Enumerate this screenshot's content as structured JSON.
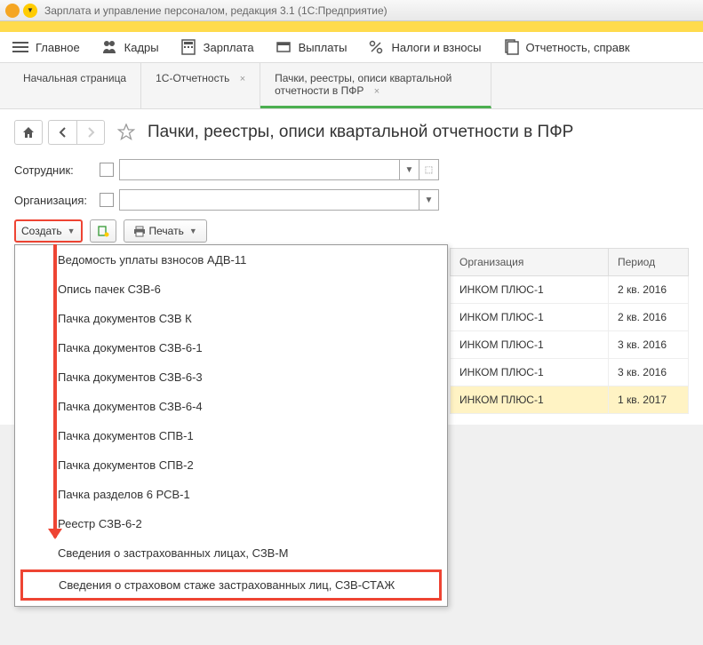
{
  "window": {
    "title": "Зарплата и управление персоналом, редакция 3.1  (1С:Предприятие)"
  },
  "menu": {
    "items": [
      {
        "label": "Главное"
      },
      {
        "label": "Кадры"
      },
      {
        "label": "Зарплата"
      },
      {
        "label": "Выплаты"
      },
      {
        "label": "Налоги и взносы"
      },
      {
        "label": "Отчетность, справк"
      }
    ]
  },
  "tabs": [
    {
      "label": "Начальная страница"
    },
    {
      "label": "1С-Отчетность"
    },
    {
      "label": "Пачки, реестры, описи квартальной отчетности в ПФР",
      "active": true
    }
  ],
  "page": {
    "title": "Пачки, реестры, описи квартальной отчетности в ПФР"
  },
  "filters": {
    "employee_label": "Сотрудник:",
    "org_label": "Организация:"
  },
  "toolbar": {
    "create_label": "Создать",
    "print_label": "Печать"
  },
  "dropdown": {
    "items": [
      "Ведомость уплаты взносов АДВ-11",
      "Опись пачек СЗВ-6",
      "Пачка документов СЗВ К",
      "Пачка документов СЗВ-6-1",
      "Пачка документов СЗВ-6-3",
      "Пачка документов СЗВ-6-4",
      "Пачка документов СПВ-1",
      "Пачка документов СПВ-2",
      "Пачка разделов 6 РСВ-1",
      "Реестр СЗВ-6-2",
      "Сведения о застрахованных лицах, СЗВ-М",
      "Сведения о страховом стаже застрахованных лиц, СЗВ-СТАЖ"
    ]
  },
  "table": {
    "col_org": "Организация",
    "col_period": "Период",
    "rows": [
      {
        "org": "ИНКОМ ПЛЮС-1",
        "period": "2 кв. 2016"
      },
      {
        "org": "ИНКОМ ПЛЮС-1",
        "period": "2 кв. 2016"
      },
      {
        "org": "ИНКОМ ПЛЮС-1",
        "period": "3 кв. 2016"
      },
      {
        "org": "ИНКОМ ПЛЮС-1",
        "period": "3 кв. 2016"
      },
      {
        "org": "ИНКОМ ПЛЮС-1",
        "period": "1 кв. 2017"
      }
    ]
  }
}
